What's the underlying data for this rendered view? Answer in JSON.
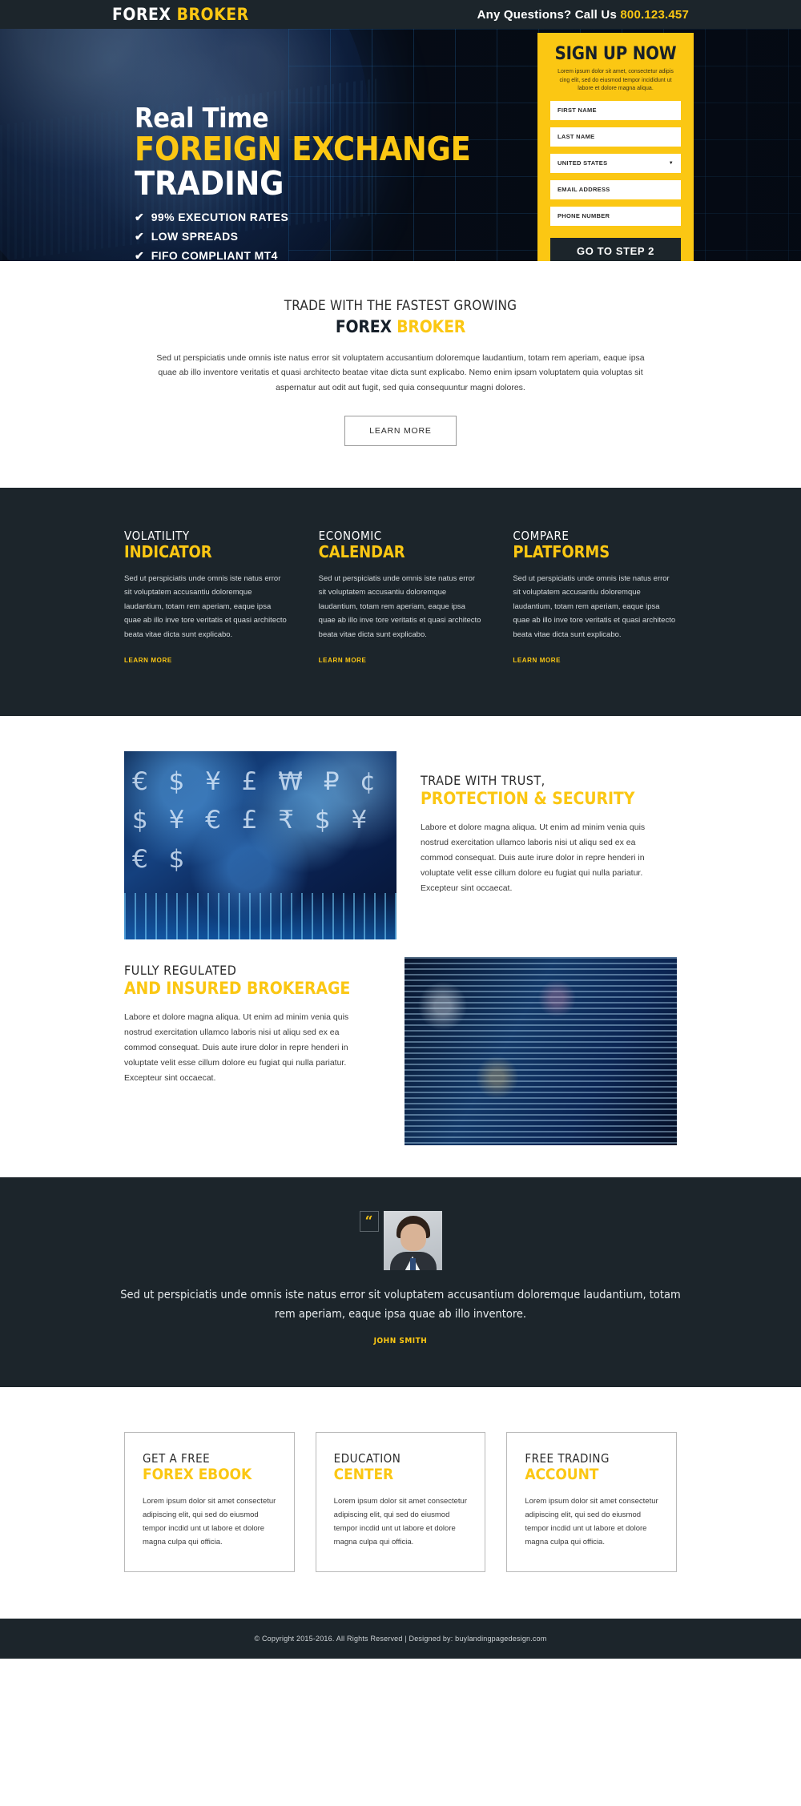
{
  "topbar": {
    "logo_white": "FOREX",
    "logo_yellow": "BROKER",
    "call_label": "Any Questions? Call Us ",
    "call_number": "800.123.457"
  },
  "hero": {
    "headline_line1": "Real Time",
    "headline_line2": "FOREIGN EXCHANGE",
    "headline_line3": "TRADING",
    "tick": "✔",
    "bullets": [
      "99% EXECUTION RATES",
      "LOW SPREADS",
      "FIFO COMPLIANT MT4"
    ]
  },
  "signup": {
    "title": "SIGN UP NOW",
    "subtitle": "Lorem ipsum dolor sit amet, consectetur adipis cing elit, sed do eiusmod tempor incididunt ut labore et dolore magna aliqua.",
    "fields": [
      {
        "name": "first-name",
        "placeholder": "FIRST NAME",
        "value": ""
      },
      {
        "name": "last-name",
        "placeholder": "LAST NAME",
        "value": ""
      },
      {
        "name": "country-select",
        "placeholder": "UNITED STATES",
        "value": "UNITED STATES"
      },
      {
        "name": "email",
        "placeholder": "EMAIL ADDRESS",
        "value": ""
      },
      {
        "name": "phone",
        "placeholder": "PHONE NUMBER",
        "value": ""
      }
    ],
    "field_labels": {
      "first_name": "FIRST NAME",
      "last_name": "LAST NAME",
      "country": "UNITED STATES",
      "email": "EMAIL ADDRESS",
      "phone": "PHONE NUMBER"
    },
    "submit_label": "GO TO STEP 2",
    "dropdown_caret": "▼"
  },
  "intro": {
    "line1": "TRADE WITH THE FASTEST GROWING",
    "line2_dark": "FOREX",
    "line2_yellow": "BROKER",
    "paragraph": "Sed ut perspiciatis unde omnis iste natus error sit voluptatem accusantium doloremque laudantium, totam rem aperiam, eaque ipsa quae ab illo inventore veritatis et quasi architecto beatae vitae dicta sunt explicabo. Nemo enim ipsam voluptatem quia voluptas sit aspernatur aut odit aut fugit, sed quia consequuntur magni dolores.",
    "button_label": "LEARN MORE"
  },
  "dark_columns": [
    {
      "title_top": "VOLATILITY",
      "title_bottom": "INDICATOR",
      "body": "Sed ut perspiciatis unde omnis iste natus error sit voluptatem accusantiu doloremque laudantium, totam rem aperiam, eaque ipsa quae ab illo inve tore veritatis et quasi architecto beata vitae dicta sunt explicabo.",
      "link": "LEARN MORE"
    },
    {
      "title_top": "ECONOMIC",
      "title_bottom": "CALENDAR",
      "body": "Sed ut perspiciatis unde omnis iste natus error sit voluptatem accusantiu doloremque laudantium, totam rem aperiam, eaque ipsa quae ab illo inve tore veritatis et quasi architecto beata vitae dicta sunt explicabo.",
      "link": "LEARN MORE"
    },
    {
      "title_top": "COMPARE",
      "title_bottom": "PLATFORMS",
      "body": "Sed ut perspiciatis unde omnis iste natus error sit voluptatem accusantiu doloremque laudantium, totam rem aperiam, eaque ipsa quae ab illo inve tore veritatis et quasi architecto beata vitae dicta sunt explicabo.",
      "link": "LEARN MORE"
    }
  ],
  "features": [
    {
      "image_name": "currency-symbols-image",
      "title_top": "TRADE WITH TRUST,",
      "title_bottom": "PROTECTION & SECURITY",
      "body": "Labore et dolore magna aliqua. Ut enim ad minim venia quis nostrud exercitation ullamco laboris nisi ut aliqu sed ex ea commod consequat. Duis aute irure dolor in repre henderi in voluptate velit esse cillum dolore eu fugiat qui nulla pariatur. Excepteur sint occaecat."
    },
    {
      "image_name": "city-stock-ticker-image",
      "title_top": "FULLY REGULATED",
      "title_bottom": "AND INSURED BROKERAGE",
      "body": "Labore et dolore magna aliqua. Ut enim ad minim venia quis nostrud exercitation ullamco laboris nisi ut aliqu sed ex ea commod consequat. Duis aute irure dolor in repre henderi in voluptate velit esse cillum dolore eu fugiat qui nulla pariatur. Excepteur sint occaecat."
    }
  ],
  "testimonial": {
    "quote_mark": "“",
    "quote": "Sed ut perspiciatis unde omnis iste natus error sit voluptatem accusantium doloremque laudantium, totam rem aperiam, eaque ipsa quae ab illo inventore.",
    "author": "JOHN SMITH"
  },
  "bottom_boxes": [
    {
      "title_top": "GET A FREE",
      "title_bottom": "FOREX EBOOK",
      "body": "Lorem ipsum dolor sit amet consectetur adipiscing elit, qui sed do eiusmod tempor incdid unt ut labore et dolore magna culpa qui officia."
    },
    {
      "title_top": "EDUCATION",
      "title_bottom": "CENTER",
      "body": "Lorem ipsum dolor sit amet consectetur adipiscing elit, qui sed do eiusmod tempor incdid unt ut labore et dolore magna culpa qui officia."
    },
    {
      "title_top": "FREE TRADING",
      "title_bottom": "ACCOUNT",
      "body": "Lorem ipsum dolor sit amet consectetur adipiscing elit, qui sed do eiusmod tempor incdid unt ut labore et dolore magna culpa qui officia."
    }
  ],
  "footer": {
    "text": "© Copyright 2015-2016. All Rights Reserved  |  Designed by: buylandingpagedesign.com"
  },
  "colors": {
    "accent_yellow": "#fbc713",
    "dark_navy": "#1c252b",
    "white": "#ffffff"
  }
}
